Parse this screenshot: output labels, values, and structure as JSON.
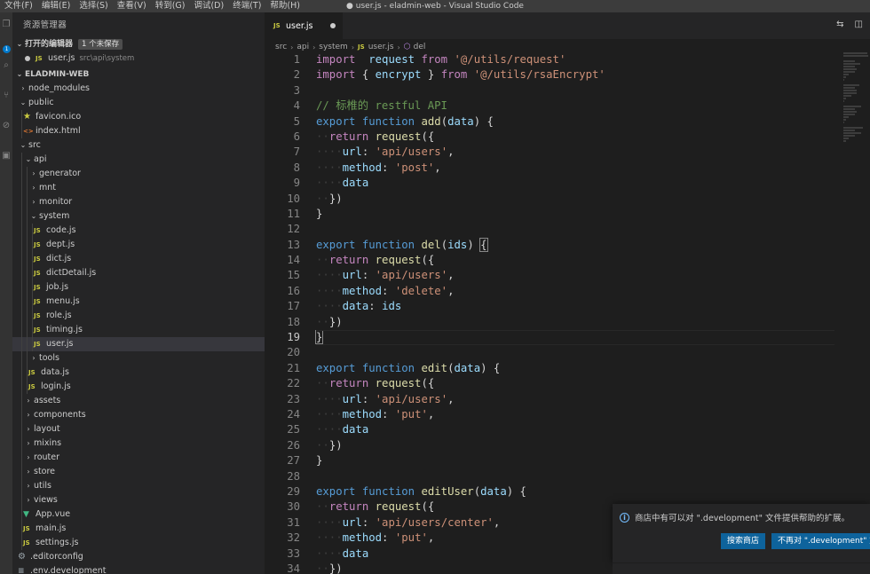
{
  "menu": [
    "文件(F)",
    "编辑(E)",
    "选择(S)",
    "查看(V)",
    "转到(G)",
    "调试(D)",
    "终端(T)",
    "帮助(H)"
  ],
  "window_title": "● user.js - eladmin-web - Visual Studio Code",
  "activity_badge": "1",
  "sidebar": {
    "title": "资源管理器",
    "open_editors": {
      "header": "打开的编辑器",
      "unsaved_badge": "1 个未保存",
      "file_name": "user.js",
      "file_path": "src\\api\\system"
    },
    "project": "ELADMIN-WEB",
    "tree": [
      {
        "label": "node_modules",
        "indent": 1,
        "kind": "folder-closed"
      },
      {
        "label": "public",
        "indent": 1,
        "kind": "folder-open"
      },
      {
        "label": "favicon.ico",
        "indent": 2,
        "kind": "star"
      },
      {
        "label": "index.html",
        "indent": 2,
        "kind": "html"
      },
      {
        "label": "src",
        "indent": 1,
        "kind": "folder-open"
      },
      {
        "label": "api",
        "indent": 2,
        "kind": "folder-open"
      },
      {
        "label": "generator",
        "indent": 3,
        "kind": "folder-closed"
      },
      {
        "label": "mnt",
        "indent": 3,
        "kind": "folder-closed"
      },
      {
        "label": "monitor",
        "indent": 3,
        "kind": "folder-closed"
      },
      {
        "label": "system",
        "indent": 3,
        "kind": "folder-open"
      },
      {
        "label": "code.js",
        "indent": 4,
        "kind": "js"
      },
      {
        "label": "dept.js",
        "indent": 4,
        "kind": "js"
      },
      {
        "label": "dict.js",
        "indent": 4,
        "kind": "js"
      },
      {
        "label": "dictDetail.js",
        "indent": 4,
        "kind": "js"
      },
      {
        "label": "job.js",
        "indent": 4,
        "kind": "js"
      },
      {
        "label": "menu.js",
        "indent": 4,
        "kind": "js"
      },
      {
        "label": "role.js",
        "indent": 4,
        "kind": "js"
      },
      {
        "label": "timing.js",
        "indent": 4,
        "kind": "js"
      },
      {
        "label": "user.js",
        "indent": 4,
        "kind": "js",
        "selected": true
      },
      {
        "label": "tools",
        "indent": 3,
        "kind": "folder-closed"
      },
      {
        "label": "data.js",
        "indent": 3,
        "kind": "js"
      },
      {
        "label": "login.js",
        "indent": 3,
        "kind": "js"
      },
      {
        "label": "assets",
        "indent": 2,
        "kind": "folder-closed"
      },
      {
        "label": "components",
        "indent": 2,
        "kind": "folder-closed"
      },
      {
        "label": "layout",
        "indent": 2,
        "kind": "folder-closed"
      },
      {
        "label": "mixins",
        "indent": 2,
        "kind": "folder-closed"
      },
      {
        "label": "router",
        "indent": 2,
        "kind": "folder-closed"
      },
      {
        "label": "store",
        "indent": 2,
        "kind": "folder-closed"
      },
      {
        "label": "utils",
        "indent": 2,
        "kind": "folder-closed"
      },
      {
        "label": "views",
        "indent": 2,
        "kind": "folder-closed"
      },
      {
        "label": "App.vue",
        "indent": 2,
        "kind": "vue"
      },
      {
        "label": "main.js",
        "indent": 2,
        "kind": "js"
      },
      {
        "label": "settings.js",
        "indent": 2,
        "kind": "js"
      },
      {
        "label": ".editorconfig",
        "indent": 1,
        "kind": "gear"
      },
      {
        "label": ".env.development",
        "indent": 1,
        "kind": "env"
      }
    ]
  },
  "editor": {
    "tab_label": "user.js",
    "tab_icon": "JS",
    "breadcrumb": [
      "src",
      "api",
      "system",
      "user.js",
      "del"
    ],
    "current_line": 19,
    "lines": [
      [
        [
          "kw2",
          "import"
        ],
        [
          "",
          "  "
        ],
        [
          "prop",
          "request"
        ],
        [
          "",
          " "
        ],
        [
          "kw2",
          "from"
        ],
        [
          "",
          " "
        ],
        [
          "str",
          "'@/utils/request'"
        ]
      ],
      [
        [
          "kw2",
          "import"
        ],
        [
          "",
          " { "
        ],
        [
          "prop",
          "encrypt"
        ],
        [
          "",
          " } "
        ],
        [
          "kw2",
          "from"
        ],
        [
          "",
          " "
        ],
        [
          "str",
          "'@/utils/rsaEncrypt'"
        ]
      ],
      [],
      [
        [
          "cmt",
          "// 标椎的 restful API"
        ]
      ],
      [
        [
          "kw",
          "export"
        ],
        [
          "",
          " "
        ],
        [
          "kw",
          "function"
        ],
        [
          "",
          " "
        ],
        [
          "fn",
          "add"
        ],
        [
          "",
          "("
        ],
        [
          "prop",
          "data"
        ],
        [
          "",
          ") {"
        ]
      ],
      [
        [
          "ws",
          "··"
        ],
        [
          "kw2",
          "return"
        ],
        [
          "",
          " "
        ],
        [
          "fn",
          "request"
        ],
        [
          "",
          "({"
        ]
      ],
      [
        [
          "ws",
          "····"
        ],
        [
          "prop",
          "url"
        ],
        [
          "",
          ": "
        ],
        [
          "str",
          "'api/users'"
        ],
        [
          "",
          ","
        ]
      ],
      [
        [
          "ws",
          "····"
        ],
        [
          "prop",
          "method"
        ],
        [
          "",
          ": "
        ],
        [
          "str",
          "'post'"
        ],
        [
          "",
          ","
        ]
      ],
      [
        [
          "ws",
          "····"
        ],
        [
          "prop",
          "data"
        ]
      ],
      [
        [
          "ws",
          "··"
        ],
        [
          "",
          "})"
        ]
      ],
      [
        [
          "",
          "}"
        ]
      ],
      [],
      [
        [
          "kw",
          "export"
        ],
        [
          "",
          " "
        ],
        [
          "kw",
          "function"
        ],
        [
          "",
          " "
        ],
        [
          "fn",
          "del"
        ],
        [
          "",
          "("
        ],
        [
          "prop",
          "ids"
        ],
        [
          "",
          ") "
        ],
        [
          "brace",
          "{"
        ]
      ],
      [
        [
          "ws",
          "··"
        ],
        [
          "kw2",
          "return"
        ],
        [
          "",
          " "
        ],
        [
          "fn",
          "request"
        ],
        [
          "",
          "({"
        ]
      ],
      [
        [
          "ws",
          "····"
        ],
        [
          "prop",
          "url"
        ],
        [
          "",
          ": "
        ],
        [
          "str",
          "'api/users'"
        ],
        [
          "",
          ","
        ]
      ],
      [
        [
          "ws",
          "····"
        ],
        [
          "prop",
          "method"
        ],
        [
          "",
          ": "
        ],
        [
          "str",
          "'delete'"
        ],
        [
          "",
          ","
        ]
      ],
      [
        [
          "ws",
          "····"
        ],
        [
          "prop",
          "data"
        ],
        [
          "",
          ": "
        ],
        [
          "prop",
          "ids"
        ]
      ],
      [
        [
          "ws",
          "··"
        ],
        [
          "",
          "})"
        ]
      ],
      [
        [
          "brace",
          "}"
        ]
      ],
      [],
      [
        [
          "kw",
          "export"
        ],
        [
          "",
          " "
        ],
        [
          "kw",
          "function"
        ],
        [
          "",
          " "
        ],
        [
          "fn",
          "edit"
        ],
        [
          "",
          "("
        ],
        [
          "prop",
          "data"
        ],
        [
          "",
          ") {"
        ]
      ],
      [
        [
          "ws",
          "··"
        ],
        [
          "kw2",
          "return"
        ],
        [
          "",
          " "
        ],
        [
          "fn",
          "request"
        ],
        [
          "",
          "({"
        ]
      ],
      [
        [
          "ws",
          "····"
        ],
        [
          "prop",
          "url"
        ],
        [
          "",
          ": "
        ],
        [
          "str",
          "'api/users'"
        ],
        [
          "",
          ","
        ]
      ],
      [
        [
          "ws",
          "····"
        ],
        [
          "prop",
          "method"
        ],
        [
          "",
          ": "
        ],
        [
          "str",
          "'put'"
        ],
        [
          "",
          ","
        ]
      ],
      [
        [
          "ws",
          "····"
        ],
        [
          "prop",
          "data"
        ]
      ],
      [
        [
          "ws",
          "··"
        ],
        [
          "",
          "})"
        ]
      ],
      [
        [
          "",
          "}"
        ]
      ],
      [],
      [
        [
          "kw",
          "export"
        ],
        [
          "",
          " "
        ],
        [
          "kw",
          "function"
        ],
        [
          "",
          " "
        ],
        [
          "fn",
          "editUser"
        ],
        [
          "",
          "("
        ],
        [
          "prop",
          "data"
        ],
        [
          "",
          ") {"
        ]
      ],
      [
        [
          "ws",
          "··"
        ],
        [
          "kw2",
          "return"
        ],
        [
          "",
          " "
        ],
        [
          "fn",
          "request"
        ],
        [
          "",
          "({"
        ]
      ],
      [
        [
          "ws",
          "····"
        ],
        [
          "prop",
          "url"
        ],
        [
          "",
          ": "
        ],
        [
          "str",
          "'api/users/center'"
        ],
        [
          "",
          ","
        ]
      ],
      [
        [
          "ws",
          "····"
        ],
        [
          "prop",
          "method"
        ],
        [
          "",
          ": "
        ],
        [
          "str",
          "'put'"
        ],
        [
          "",
          ","
        ]
      ],
      [
        [
          "ws",
          "····"
        ],
        [
          "prop",
          "data"
        ]
      ],
      [
        [
          "ws",
          "··"
        ],
        [
          "",
          "})"
        ]
      ]
    ]
  },
  "notification": {
    "message": "商店中有可以对 \".development\" 文件提供帮助的扩展。",
    "primary_button": "搜索商店",
    "secondary_button": "不再对 \".development\" 文件"
  },
  "colors": {
    "accent": "#007acc",
    "button": "#0e639c",
    "sidebar_bg": "#252526",
    "editor_bg": "#1e1e1e"
  }
}
